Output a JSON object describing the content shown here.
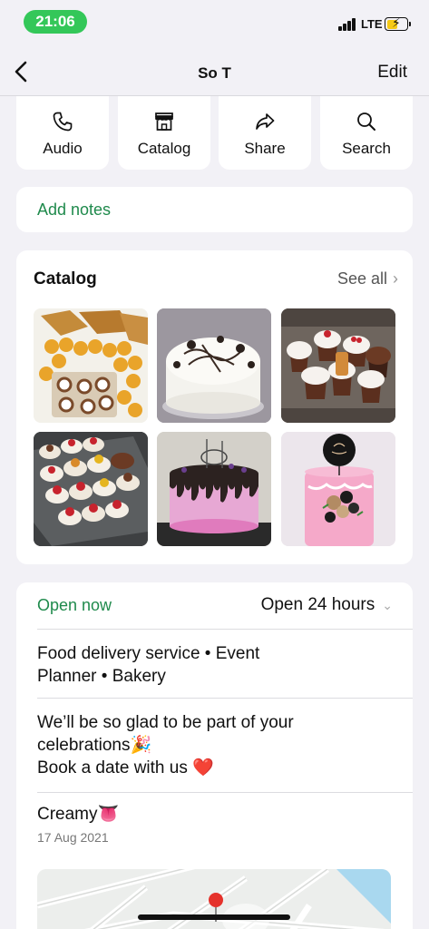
{
  "status": {
    "time": "21:06",
    "network": "LTE"
  },
  "nav": {
    "title": "So T",
    "edit_label": "Edit"
  },
  "actions": [
    {
      "label": "Audio",
      "icon": "phone-icon"
    },
    {
      "label": "Catalog",
      "icon": "storefront-icon"
    },
    {
      "label": "Share",
      "icon": "share-arrow-icon"
    },
    {
      "label": "Search",
      "icon": "search-icon"
    }
  ],
  "notes": {
    "label": "Add notes"
  },
  "catalog": {
    "title": "Catalog",
    "see_all": "See all",
    "items": [
      "samosa-and-puff-puff-platter",
      "cookies-and-cream-cake",
      "cupcakes-with-berries-and-biscuits",
      "assorted-cupcakes-tray",
      "pink-drip-cake",
      "pink-birthday-cake-with-topper"
    ]
  },
  "business": {
    "status": "Open now",
    "hours": "Open 24 hours",
    "categories_line1": "Food delivery service • Event",
    "categories_line2": "Planner • Bakery",
    "about_line1": "We’ll be so glad to be part of your",
    "about_line2": "celebrations🎉",
    "about_line3": "Book a date with us",
    "heart": "❤️",
    "status_text": "Creamy👅",
    "status_date": "17 Aug 2021"
  },
  "colors": {
    "accent_green": "#1f8a4c",
    "time_pill": "#34c759",
    "background": "#f2f1f6"
  }
}
